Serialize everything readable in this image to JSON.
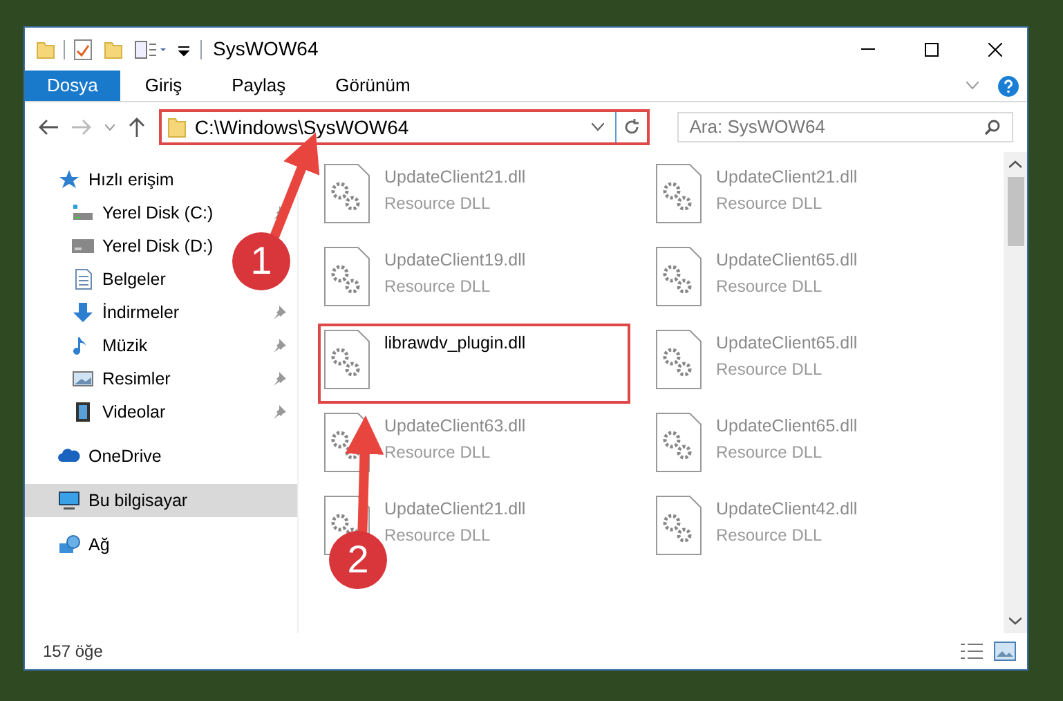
{
  "window": {
    "title": "SysWOW64"
  },
  "ribbon_tabs": [
    {
      "label": "Dosya",
      "selected": true
    },
    {
      "label": "Giriş",
      "selected": false
    },
    {
      "label": "Paylaş",
      "selected": false
    },
    {
      "label": "Görünüm",
      "selected": false
    }
  ],
  "address": {
    "value": "C:\\Windows\\SysWOW64"
  },
  "search": {
    "placeholder": "Ara: SysWOW64"
  },
  "sidebar": {
    "items": [
      {
        "kind": "star",
        "label": "Hızlı erişim",
        "selected": false,
        "children": [
          {
            "kind": "drive-c",
            "label": "Yerel Disk (C:)",
            "selected": false,
            "pinned": true
          },
          {
            "kind": "drive",
            "label": "Yerel Disk (D:)",
            "selected": false,
            "pinned": false
          },
          {
            "kind": "doc",
            "label": "Belgeler",
            "selected": false,
            "pinned": false
          },
          {
            "kind": "download",
            "label": "İndirmeler",
            "selected": false,
            "pinned": true
          },
          {
            "kind": "music",
            "label": "Müzik",
            "selected": false,
            "pinned": true
          },
          {
            "kind": "picture",
            "label": "Resimler",
            "selected": false,
            "pinned": true
          },
          {
            "kind": "video",
            "label": "Videolar",
            "selected": false,
            "pinned": true
          }
        ]
      },
      {
        "kind": "cloud",
        "label": "OneDrive",
        "selected": false
      },
      {
        "kind": "pc",
        "label": "Bu bilgisayar",
        "selected": true
      },
      {
        "kind": "network",
        "label": "Ağ",
        "selected": false
      }
    ]
  },
  "files": [
    {
      "name": "UpdateClient21.dll",
      "type": "Resource DLL",
      "highlighted": false
    },
    {
      "name": "UpdateClient21.dll",
      "type": "Resource DLL",
      "highlighted": false
    },
    {
      "name": "UpdateClient19.dll",
      "type": "Resource DLL",
      "highlighted": false
    },
    {
      "name": "UpdateClient65.dll",
      "type": "Resource DLL",
      "highlighted": false
    },
    {
      "name": "librawdv_plugin.dll",
      "highlighted": true
    },
    {
      "name": "UpdateClient65.dll",
      "type": "Resource DLL",
      "highlighted": false
    },
    {
      "name": "UpdateClient63.dll",
      "type": "Resource DLL",
      "highlighted": false
    },
    {
      "name": "UpdateClient65.dll",
      "type": "Resource DLL",
      "highlighted": false
    },
    {
      "name": "UpdateClient21.dll",
      "type": "Resource DLL",
      "highlighted": false
    },
    {
      "name": "UpdateClient42.dll",
      "type": "Resource DLL",
      "highlighted": false
    }
  ],
  "status_bar": {
    "count": "157 öğe"
  },
  "annotations": [
    {
      "number": "1"
    },
    {
      "number": "2"
    }
  ]
}
